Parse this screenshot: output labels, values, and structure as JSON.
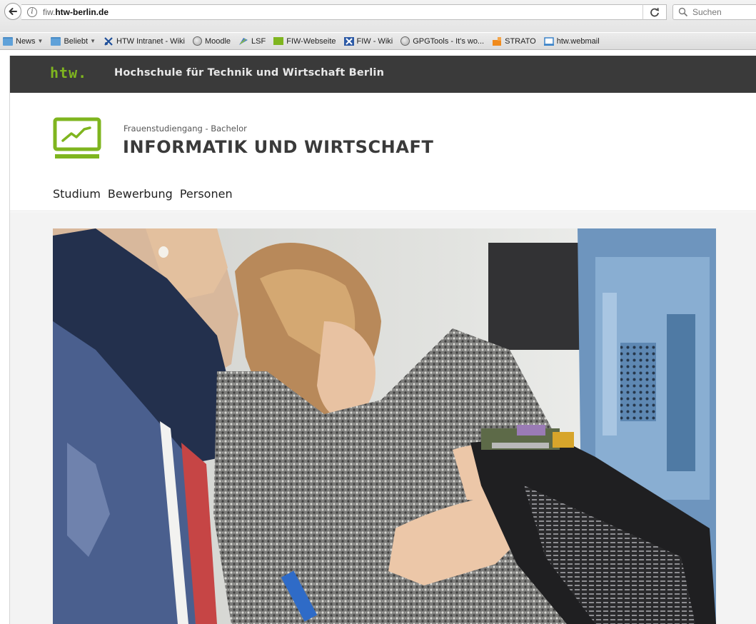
{
  "browser": {
    "url_prefix": "fiw.",
    "url_host": "htw-berlin.de",
    "search_placeholder": "Suchen",
    "bookmarks": [
      {
        "label": "News",
        "icon": "folder-icon",
        "dropdown": true
      },
      {
        "label": "Beliebt",
        "icon": "folder-icon",
        "dropdown": true
      },
      {
        "label": "HTW Intranet - Wiki",
        "icon": "wiki-icon"
      },
      {
        "label": "Moodle",
        "icon": "globe-icon"
      },
      {
        "label": "LSF",
        "icon": "lsf-icon"
      },
      {
        "label": "FIW-Webseite",
        "icon": "htw-icon"
      },
      {
        "label": "FIW - Wiki",
        "icon": "wiki-icon"
      },
      {
        "label": "GPGTools - It's wo...",
        "icon": "globe-icon"
      },
      {
        "label": "STRATO",
        "icon": "strato-icon"
      },
      {
        "label": "htw.webmail",
        "icon": "mail-icon"
      }
    ]
  },
  "site": {
    "logo_text": "htw.",
    "university_name": "Hochschule für Technik und Wirtschaft Berlin",
    "program_subtitle": "Frauenstudiengang - Bachelor",
    "program_title": "INFORMATIK UND WIRTSCHAFT",
    "nav": [
      "Studium",
      "Bewerbung",
      "Personen"
    ],
    "accent_color": "#7fb51f",
    "header_bg": "#3a3a3a"
  },
  "hero": {
    "image_subject": "two-students-with-circuit-board-photo"
  }
}
